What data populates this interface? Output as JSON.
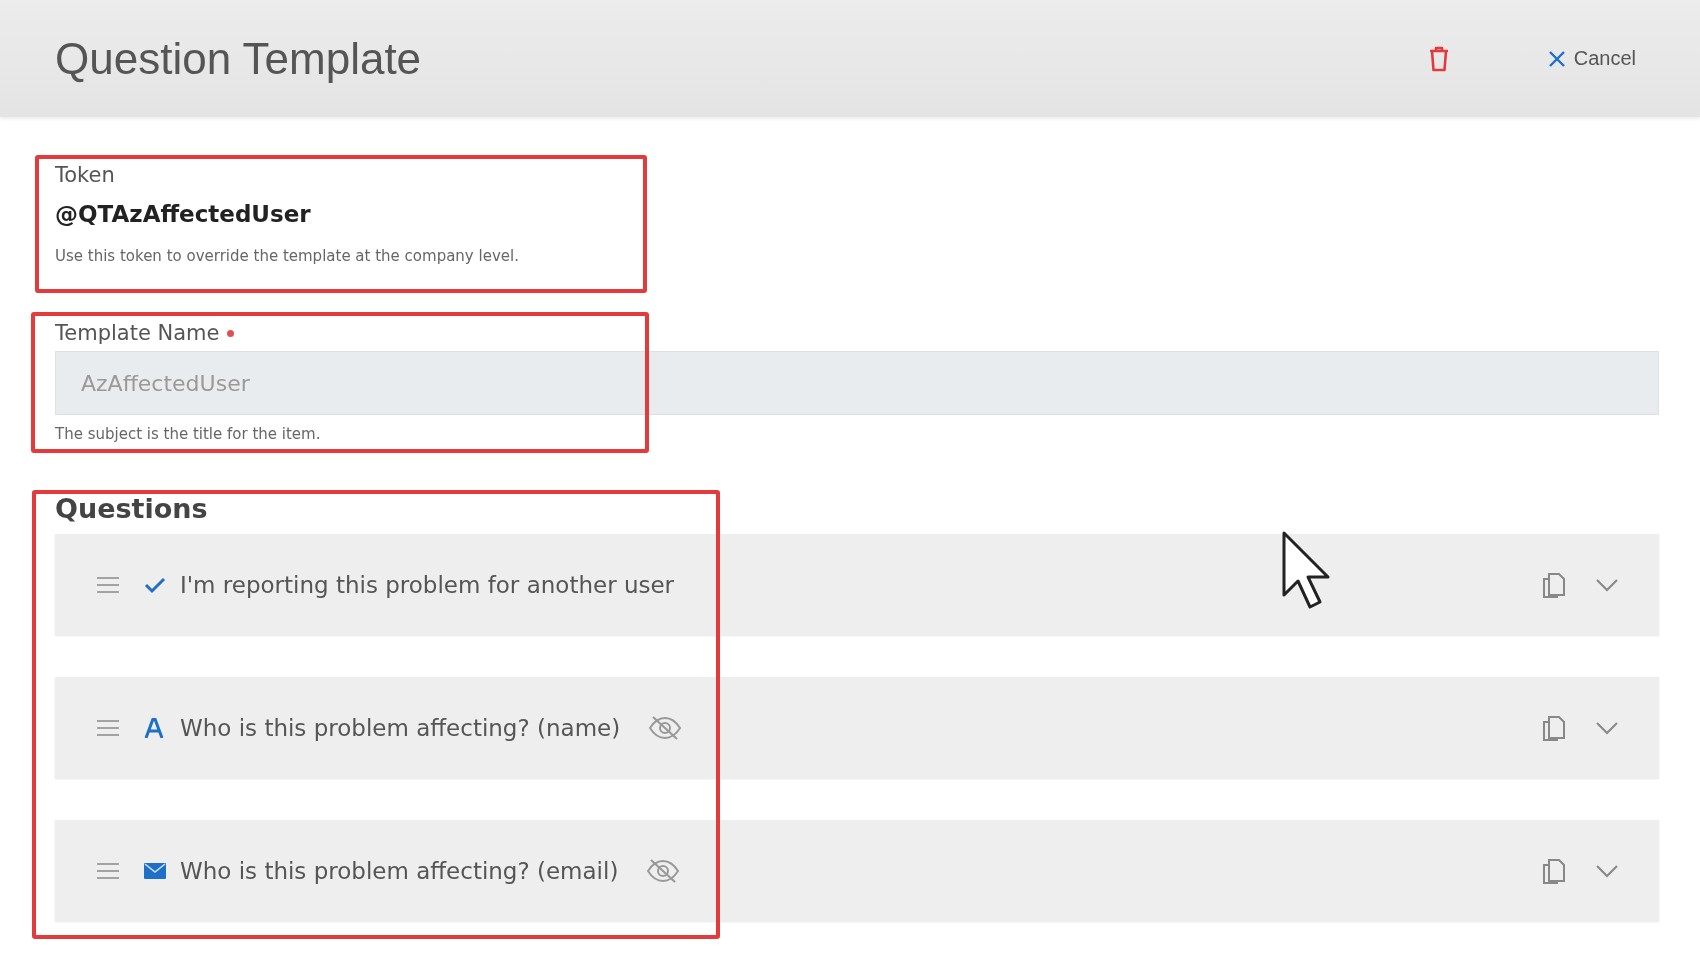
{
  "header": {
    "title": "Question Template",
    "cancel": "Cancel"
  },
  "token": {
    "label": "Token",
    "value": "@QTAzAffectedUser",
    "hint": "Use this token to override the template at the company level."
  },
  "template_name": {
    "label": "Template Name",
    "required": true,
    "value": "AzAffectedUser",
    "hint": "The subject is the title for the item."
  },
  "questions": {
    "heading": "Questions",
    "items": [
      {
        "kind": "checkbox",
        "label": "I'm reporting this problem for another user",
        "hidden": false
      },
      {
        "kind": "text",
        "label": "Who is this problem affecting? (name)",
        "hidden": true
      },
      {
        "kind": "email",
        "label": "Who is this problem affecting? (email)",
        "hidden": true
      }
    ]
  }
}
